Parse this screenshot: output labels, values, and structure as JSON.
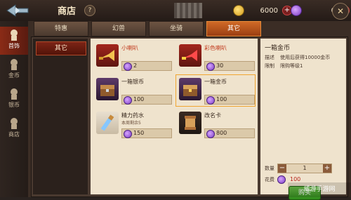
{
  "header": {
    "title": "商店",
    "help": "?",
    "resources": [
      {
        "icon": "gold-coin-icon",
        "value": "6000"
      },
      {
        "icon": "purple-gem-icon",
        "value": "0"
      }
    ],
    "close": "✕"
  },
  "sidebar": {
    "items": [
      {
        "label": "首饰",
        "active": true
      },
      {
        "label": "金币",
        "active": false
      },
      {
        "label": "银币",
        "active": false
      },
      {
        "label": "商店",
        "active": false
      }
    ]
  },
  "tabs": [
    "特惠",
    "幻兽",
    "坐骑",
    "其它"
  ],
  "left_category": "其它",
  "items": [
    {
      "name": "小喇叭",
      "price": "2",
      "name_color": "#c23b1e"
    },
    {
      "name": "彩色喇叭",
      "price": "30",
      "name_color": "#c23b1e"
    },
    {
      "name": "一箱银币",
      "price": "100",
      "name_color": "#3a2a1f"
    },
    {
      "name": "一箱金币",
      "price": "100",
      "name_color": "#3a2a1f"
    },
    {
      "name": "精力药水",
      "sub": "本周剩余5",
      "price": "150",
      "name_color": "#3a2a1f"
    },
    {
      "name": "改名卡",
      "price": "800",
      "name_color": "#3a2a1f"
    }
  ],
  "detail": {
    "title": "一箱金币",
    "desc_label": "描述",
    "desc_value": "使用后获得10000金币",
    "limit_label": "限制",
    "limit_value": "限购等级1",
    "qty_label": "数量",
    "qty_value": "1",
    "cost_label": "花费",
    "cost_value": "100",
    "buy": "购买"
  },
  "watermark": "威游手游网",
  "colors": {
    "accent": "#cf6a27",
    "buy_green": "#4aa82d"
  }
}
